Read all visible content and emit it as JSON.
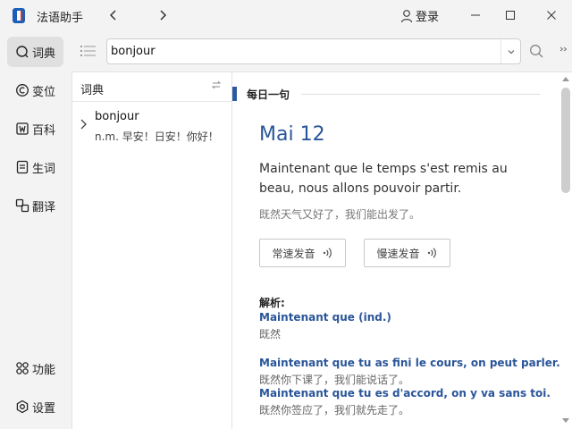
{
  "app": {
    "title": "法语助手",
    "back_icon": "chevron-left-icon",
    "forward_icon": "chevron-right-icon"
  },
  "account": {
    "login_label": "登录",
    "icon": "user-icon"
  },
  "window_controls": [
    "minimize-icon",
    "maximize-icon",
    "close-icon"
  ],
  "sidebar": {
    "items": [
      {
        "label": "词典",
        "icon": "dictionary-search-icon",
        "active": true
      },
      {
        "label": "变位",
        "icon": "conjugation-icon",
        "active": false
      },
      {
        "label": "百科",
        "icon": "encyclopedia-icon",
        "active": false
      },
      {
        "label": "生词",
        "icon": "vocabulary-icon",
        "active": false
      },
      {
        "label": "翻译",
        "icon": "translate-icon",
        "active": false
      }
    ],
    "bottom_items": [
      {
        "label": "功能",
        "icon": "apps-grid-icon"
      },
      {
        "label": "设置",
        "icon": "settings-icon"
      }
    ]
  },
  "search": {
    "value": "bonjour",
    "placeholder": ""
  },
  "dictionary_list": {
    "title": "词典",
    "entries": [
      {
        "word": "bonjour",
        "definition": "n.m. 早安！日安！你好！"
      }
    ]
  },
  "daily": {
    "section_title": "每日一句",
    "date": "Mai 12",
    "sentence_fr": "Maintenant que le temps s'est remis au beau, nous allons pouvoir partir.",
    "sentence_zh": "既然天气又好了，我们能出发了。",
    "audio_normal_label": "常速发音",
    "audio_slow_label": "慢速发音",
    "analysis_label": "解析:",
    "analysis": [
      {
        "fr": "Maintenant que (ind.)",
        "zh": "既然"
      },
      {
        "fr": "Maintenant que tu as fini le cours, on peut parler.",
        "zh": "既然你下课了，我们能说话了。"
      },
      {
        "fr": "Maintenant que tu es d'accord, on y va sans toi.",
        "zh": "既然你签应了，我们就先走了。"
      }
    ]
  },
  "colors": {
    "accent": "#2a5699",
    "section_bar": "#2c5aa0",
    "active_bg": "#e0e0e0"
  }
}
